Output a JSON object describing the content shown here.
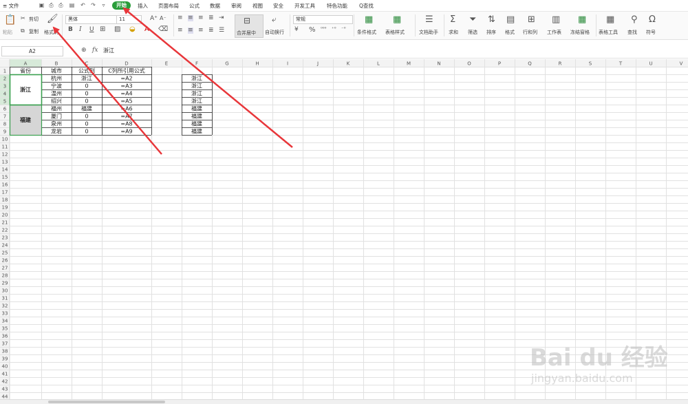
{
  "menu": {
    "file_label": "≡ 文件",
    "tabs": [
      "开始",
      "插入",
      "页面布局",
      "公式",
      "数据",
      "审阅",
      "视图",
      "安全",
      "开发工具",
      "特色功能"
    ],
    "active_tab": "开始",
    "search_label": "Q查找"
  },
  "ribbon": {
    "paste": "粘贴",
    "cut": "剪切",
    "copy": "复制",
    "format_painter": "格式刷",
    "font_name": "黑体",
    "font_size": "11",
    "bold": "B",
    "italic": "I",
    "underline": "U",
    "merge_center": "合并居中",
    "wrap_text": "自动换行",
    "number_format": "常规",
    "conditional_format": "条件格式",
    "table_style": "表格样式",
    "doc_assistant": "文档助手",
    "sum": "求和",
    "filter": "筛选",
    "sort": "排序",
    "format": "格式",
    "rows_cols": "行和列",
    "worksheet": "工作表",
    "freeze": "冻结窗格",
    "table_tools": "表格工具",
    "find": "查找",
    "symbol": "符号"
  },
  "formula_bar": {
    "cell_ref": "A2",
    "fx": "fx",
    "value": "浙江"
  },
  "columns": [
    "A",
    "B",
    "C",
    "D",
    "E",
    "F",
    "G",
    "H",
    "I",
    "J",
    "K",
    "L",
    "M",
    "N",
    "O",
    "P",
    "Q",
    "R",
    "S",
    "T",
    "U",
    "V"
  ],
  "row_count": 44,
  "table": {
    "headers": [
      "省份",
      "城市",
      "公式列",
      "C列所引用公式"
    ],
    "merged": [
      {
        "text": "浙江",
        "rows": [
          2,
          5
        ]
      },
      {
        "text": "福建",
        "rows": [
          6,
          9
        ]
      }
    ],
    "rows": [
      [
        "杭州",
        "浙江",
        "=A2"
      ],
      [
        "宁波",
        "0",
        "=A3"
      ],
      [
        "温州",
        "0",
        "=A4"
      ],
      [
        "绍兴",
        "0",
        "=A5"
      ],
      [
        "福州",
        "福建",
        "=A6"
      ],
      [
        "厦门",
        "0",
        "=A7"
      ],
      [
        "泉州",
        "0",
        "=A8"
      ],
      [
        "龙岩",
        "0",
        "=A9"
      ]
    ],
    "col_f": [
      "浙江",
      "浙江",
      "浙江",
      "浙江",
      "福建",
      "福建",
      "福建",
      "福建"
    ]
  },
  "watermark": {
    "brand": "Bai du 经验",
    "url": "jingyan.baidu.com"
  },
  "colors": {
    "accent": "#2a9d3a",
    "arrow": "#e8363a",
    "selection": "#3aa04f"
  }
}
